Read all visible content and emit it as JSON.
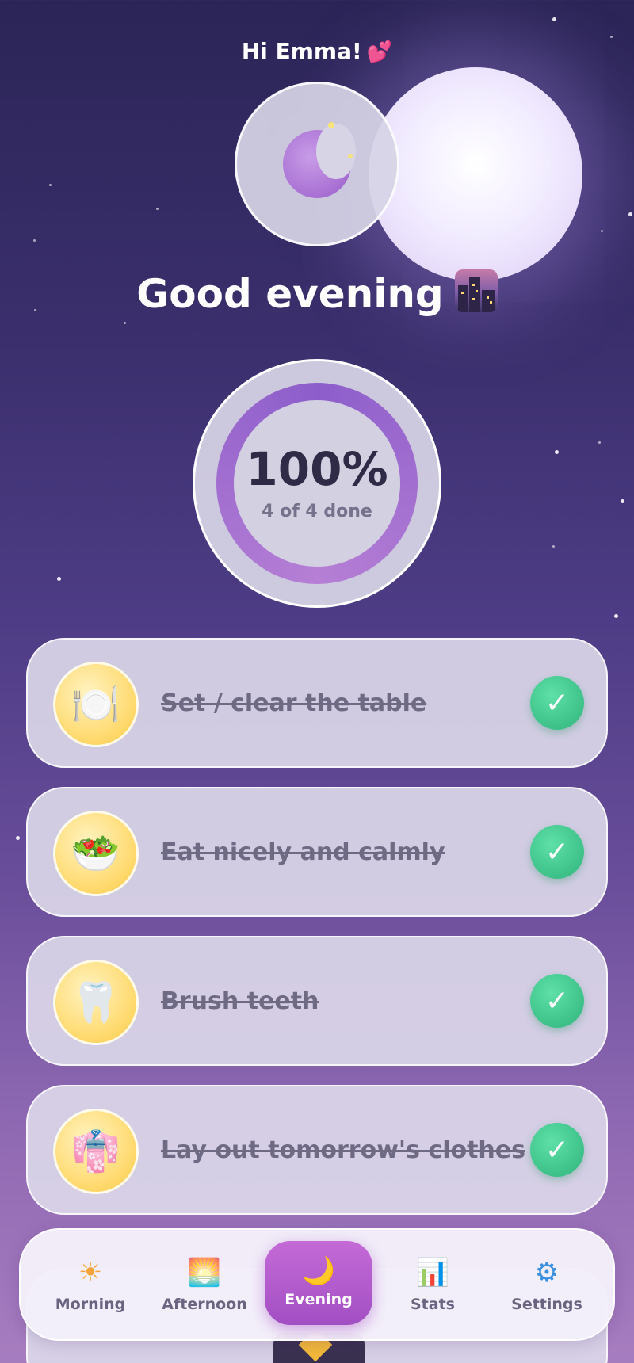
{
  "header": {
    "greeting": "Hi Emma!",
    "heart_icon": "💕",
    "avatar_icon": "crescent-moon-icon",
    "title": "Good evening",
    "title_icon": "night-city-icon"
  },
  "progress": {
    "percent_text": "100%",
    "done_text": "4 of 4 done",
    "fraction": 1.0
  },
  "tasks": [
    {
      "label": "Set / clear the table",
      "icon": "🍽️",
      "icon_name": "plate-cutlery-icon",
      "done": true,
      "check": "✓"
    },
    {
      "label": "Eat nicely and calmly",
      "icon": "🥗",
      "icon_name": "salad-bowl-icon",
      "done": true,
      "check": "✓"
    },
    {
      "label": "Brush teeth",
      "icon": "🦷",
      "icon_name": "tooth-icon",
      "done": true,
      "check": "✓"
    },
    {
      "label": "Lay out tomorrow's clothes",
      "icon": "👘",
      "icon_name": "kimono-icon",
      "done": true,
      "check": "✓"
    }
  ],
  "nav": {
    "items": [
      {
        "label": "Morning",
        "icon": "☀",
        "icon_name": "sun-icon"
      },
      {
        "label": "Afternoon",
        "icon": "🌅",
        "icon_name": "sunset-icon"
      },
      {
        "label": "Evening",
        "icon": "🌙",
        "icon_name": "moon-icon",
        "active": true
      },
      {
        "label": "Stats",
        "icon": "📊",
        "icon_name": "bar-chart-icon"
      },
      {
        "label": "Settings",
        "icon": "⚙",
        "icon_name": "gear-icon"
      }
    ]
  },
  "colors": {
    "accent": "#a24fc4",
    "check_green": "#2fb47c",
    "task_icon_bg": "#ffd86a"
  }
}
